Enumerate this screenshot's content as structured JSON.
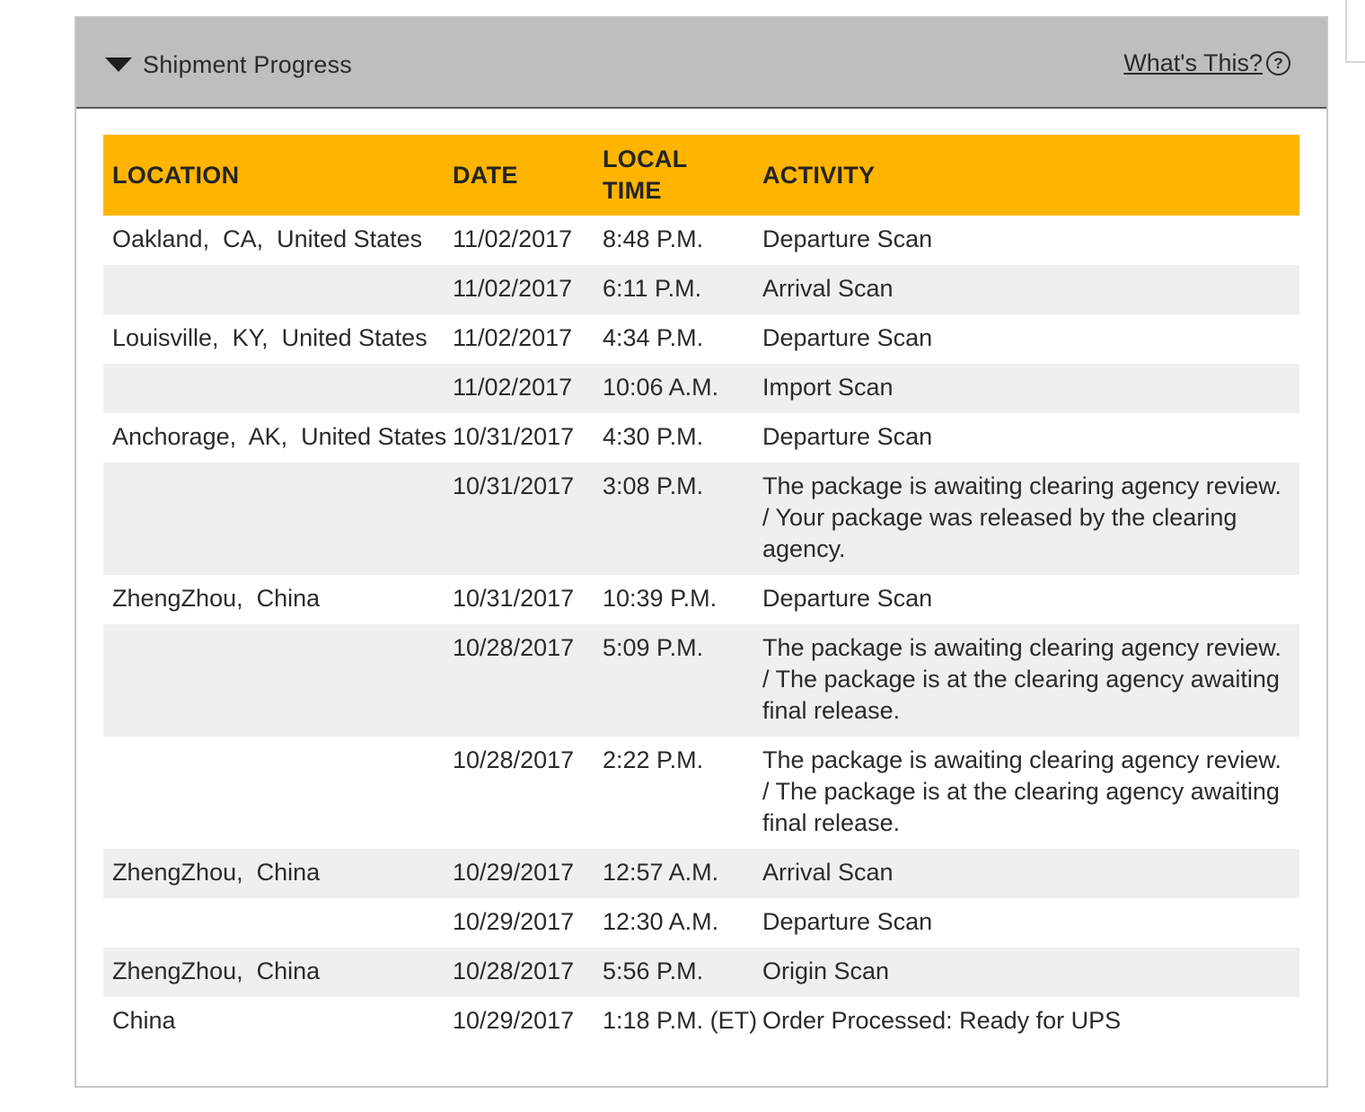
{
  "header": {
    "title": "Shipment Progress",
    "whats_this": "What's This?",
    "help_glyph": "?"
  },
  "table": {
    "columns": {
      "location": "LOCATION",
      "date": "DATE",
      "time": "LOCAL TIME",
      "activity": "ACTIVITY"
    },
    "rows": [
      {
        "location": "Oakland,  CA,  United States",
        "date": "11/02/2017",
        "time": "8:48 P.M.",
        "activity": "Departure Scan"
      },
      {
        "location": "",
        "date": "11/02/2017",
        "time": "6:11 P.M.",
        "activity": "Arrival Scan"
      },
      {
        "location": "Louisville,  KY,  United States",
        "date": "11/02/2017",
        "time": "4:34 P.M.",
        "activity": "Departure Scan"
      },
      {
        "location": "",
        "date": "11/02/2017",
        "time": "10:06 A.M.",
        "activity": "Import Scan"
      },
      {
        "location": "Anchorage,  AK,  United States",
        "date": "10/31/2017",
        "time": "4:30 P.M.",
        "activity": "Departure Scan"
      },
      {
        "location": "",
        "date": "10/31/2017",
        "time": "3:08 P.M.",
        "activity": "The package is awaiting clearing agency review. / Your package was released by the clearing agency."
      },
      {
        "location": "ZhengZhou,  China",
        "date": "10/31/2017",
        "time": "10:39 P.M.",
        "activity": "Departure Scan"
      },
      {
        "location": "",
        "date": "10/28/2017",
        "time": "5:09 P.M.",
        "activity": "The package is awaiting clearing agency review. / The package is at the clearing agency awaiting final release."
      },
      {
        "location": "",
        "date": "10/28/2017",
        "time": "2:22 P.M.",
        "activity": "The package is awaiting clearing agency review. / The package is at the clearing agency awaiting final release."
      },
      {
        "location": "ZhengZhou,  China",
        "date": "10/29/2017",
        "time": "12:57 A.M.",
        "activity": "Arrival Scan"
      },
      {
        "location": "",
        "date": "10/29/2017",
        "time": "12:30 A.M.",
        "activity": "Departure Scan"
      },
      {
        "location": "ZhengZhou,  China",
        "date": "10/28/2017",
        "time": "5:56 P.M.",
        "activity": "Origin Scan"
      },
      {
        "location": "China",
        "date": "10/29/2017",
        "time": "1:18 P.M. (ET)",
        "activity": "Order Processed: Ready for UPS"
      }
    ]
  },
  "colors": {
    "header_bg": "#bebebe",
    "table_header_bg": "#ffb500",
    "row_shade": "#efefef"
  },
  "icons": {
    "collapse": "caret-down-icon",
    "help": "help-circle-icon"
  }
}
